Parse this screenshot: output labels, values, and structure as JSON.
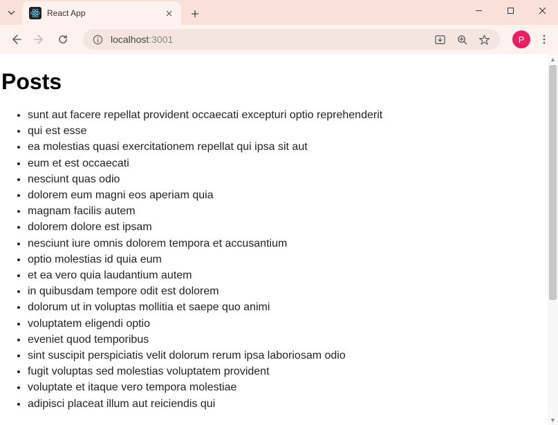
{
  "browser": {
    "tab": {
      "title": "React App"
    },
    "url_host": "localhost",
    "url_port": ":3001",
    "profile_initial": "P"
  },
  "page": {
    "heading": "Posts",
    "posts": [
      "sunt aut facere repellat provident occaecati excepturi optio reprehenderit",
      "qui est esse",
      "ea molestias quasi exercitationem repellat qui ipsa sit aut",
      "eum et est occaecati",
      "nesciunt quas odio",
      "dolorem eum magni eos aperiam quia",
      "magnam facilis autem",
      "dolorem dolore est ipsam",
      "nesciunt iure omnis dolorem tempora et accusantium",
      "optio molestias id quia eum",
      "et ea vero quia laudantium autem",
      "in quibusdam tempore odit est dolorem",
      "dolorum ut in voluptas mollitia et saepe quo animi",
      "voluptatem eligendi optio",
      "eveniet quod temporibus",
      "sint suscipit perspiciatis velit dolorum rerum ipsa laboriosam odio",
      "fugit voluptas sed molestias voluptatem provident",
      "voluptate et itaque vero tempora molestiae",
      "adipisci placeat illum aut reiciendis qui"
    ]
  }
}
